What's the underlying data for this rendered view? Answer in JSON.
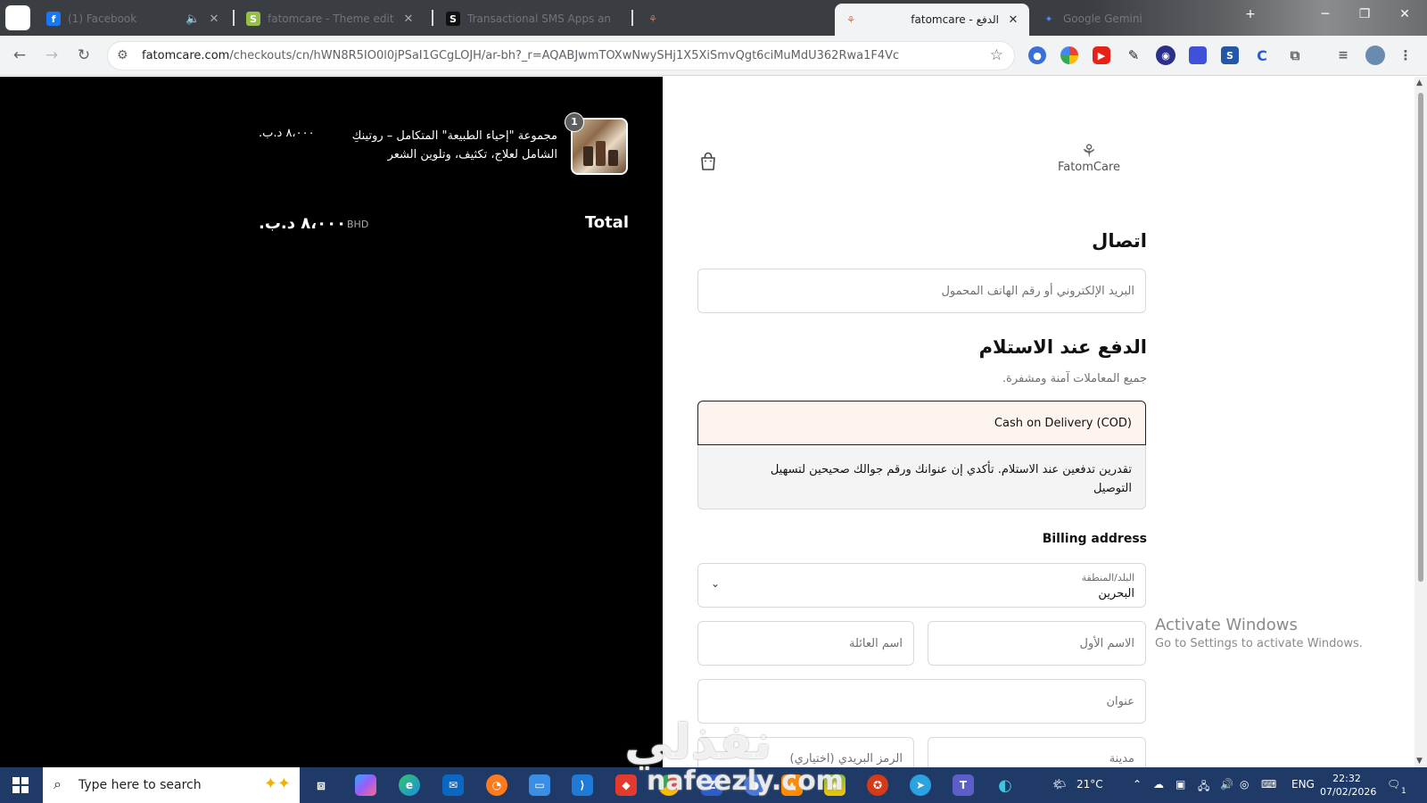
{
  "browser": {
    "tabs": [
      {
        "title": "(1) Facebook",
        "favicon": "f",
        "favicon_color": "#1877f2",
        "active": false
      },
      {
        "title": "fatomcare - Theme editor",
        "favicon": "S",
        "favicon_color": "#95bf47",
        "active": false
      },
      {
        "title": "Transactional SMS Apps an",
        "favicon": "S",
        "favicon_color": "#111111",
        "active": false
      },
      {
        "title": "",
        "favicon": "⚘",
        "favicon_color": "#c77a5a",
        "active": false
      },
      {
        "title": "fatomcare - الدفع",
        "favicon": "⚘",
        "favicon_color": "#c77a5a",
        "active": true
      },
      {
        "title": "Google Gemini",
        "favicon": "✦",
        "favicon_color": "#4f86f7",
        "active": false
      }
    ],
    "url_domain": "fatomcare.com",
    "url_path": "/checkouts/cn/hWN8R5IO0l0jPSaI1GCgLOJH/ar-bh?_r=AQABJwmTOXwNwySHj1X5XiSmvQgt6ciMuMdU362Rwa1F4Vc"
  },
  "order_summary": {
    "item": {
      "quantity": "1",
      "name": "مجموعة \"إحياء الطبيعة\" المتكامل – روتينكِ الشامل لعلاج، تكثيف، وتلوين الشعر",
      "price": "٨،٠٠٠ د.ب."
    },
    "total_label": "Total",
    "currency": "BHD",
    "total_value": "٨،٠٠٠ د.ب."
  },
  "store": {
    "logo_name": "FatomCare"
  },
  "contact": {
    "title": "اتصال",
    "email_placeholder": "البريد الإلكتروني أو رقم الهاتف المحمول"
  },
  "payment": {
    "title": "الدفع عند الاستلام",
    "subtitle": "جميع المعاملات آمنة ومشفرة.",
    "method_label": "Cash on Delivery (COD)",
    "method_description": "تقدرين تدفعين عند الاستلام. تأكدي إن عنوانك ورقم جوالك صحيحين لتسهيل التوصيل"
  },
  "billing": {
    "title": "Billing address",
    "country_label": "البلد/المنطقة",
    "country_value": "البحرين",
    "first_name_placeholder": "الاسم الأول",
    "last_name_placeholder": "اسم العائلة",
    "address_placeholder": "عنوان",
    "city_placeholder": "مدينة",
    "postal_placeholder": "الرمز البريدي (اختياري)"
  },
  "os": {
    "activate_title": "Activate Windows",
    "activate_sub": "Go to Settings to activate Windows.",
    "search_placeholder": "Type here to search",
    "weather": "21°C",
    "language": "ENG",
    "time": "22:32",
    "date": "07/02/2026",
    "notification_count": "1"
  },
  "watermark": {
    "text_ar": "نفذلي",
    "text_en": "nafeezly.com"
  },
  "colors": {
    "cod_bg": "#fdf3ef",
    "taskbar": "#1f3a66",
    "left_panel": "#000000"
  }
}
